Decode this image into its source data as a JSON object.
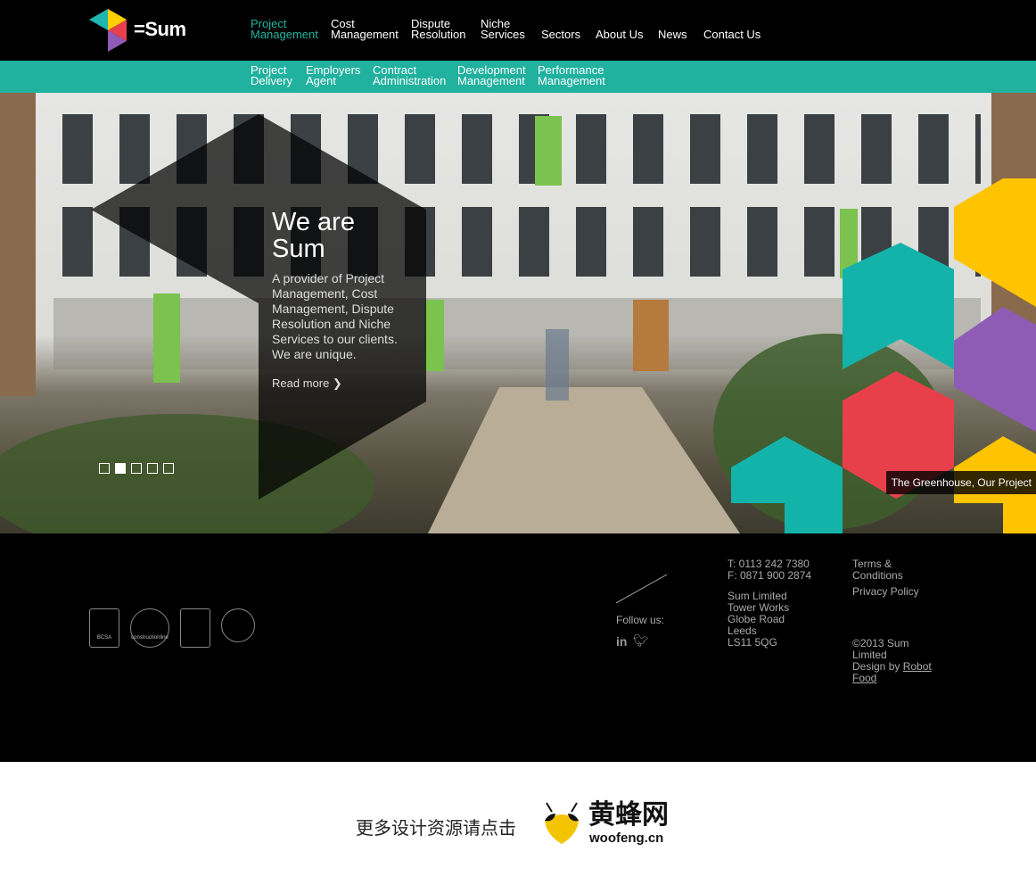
{
  "brand": {
    "name": "=Sum",
    "colors": {
      "teal": "#20b19f",
      "yellow": "#ffc400",
      "red": "#e8404a",
      "purple": "#8e5bb5"
    }
  },
  "nav": {
    "items": [
      {
        "line1": "Project",
        "line2": "Management",
        "active": true
      },
      {
        "line1": "Cost",
        "line2": "Management"
      },
      {
        "line1": "Dispute",
        "line2": "Resolution"
      },
      {
        "line1": "Niche",
        "line2": "Services"
      },
      {
        "line1": "",
        "line2": "Sectors"
      },
      {
        "line1": "",
        "line2": "About Us"
      },
      {
        "line1": "",
        "line2": "News"
      },
      {
        "line1": "",
        "line2": "Contact Us"
      }
    ]
  },
  "subnav": {
    "items": [
      {
        "line1": "Project",
        "line2": "Delivery"
      },
      {
        "line1": "Employers",
        "line2": "Agent"
      },
      {
        "line1": "Contract",
        "line2": "Administration"
      },
      {
        "line1": "Development",
        "line2": "Management"
      },
      {
        "line1": "Performance",
        "line2": "Management"
      }
    ]
  },
  "hero": {
    "title": "We are Sum",
    "description": "A provider of Project Management, Cost Management, Dispute Resolution and Niche Services to our clients. We are unique.",
    "read_more": "Read more ❯",
    "slides": 5,
    "active_slide": 2,
    "caption": "The Greenhouse, Our Project"
  },
  "footer": {
    "badges": [
      "BCSA",
      "constructionline",
      "",
      ""
    ],
    "follow_label": "Follow us:",
    "social": [
      "linkedin-icon",
      "twitter-icon"
    ],
    "phone": "T: 0113 242 7380",
    "fax": "F: 0871 900 2874",
    "address": [
      "Sum Limited",
      "Tower Works",
      "Globe Road",
      "Leeds",
      "LS11 5QG"
    ],
    "terms": "Terms & Conditions",
    "privacy": "Privacy Policy",
    "copyright": "©2013 Sum Limited",
    "design_by": "Design by ",
    "design_link": "Robot Food"
  },
  "banner": {
    "text": "更多设计资源请点击",
    "logo": "黄蜂网",
    "url": "woofeng.cn"
  }
}
